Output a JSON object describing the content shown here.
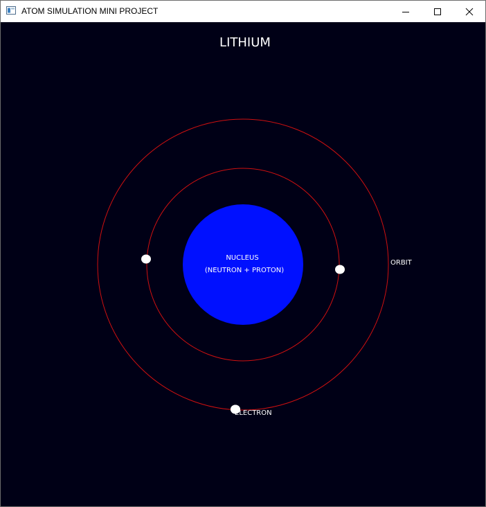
{
  "window": {
    "title": "ATOM SIMULATION MINI PROJECT",
    "controls": [
      "minimize-icon",
      "maximize-icon",
      "close-icon"
    ]
  },
  "scene": {
    "element_name": "LITHIUM",
    "nucleus_label": "NUCLEUS",
    "nucleus_sublabel": "(NEUTRON + PROTON)",
    "orbit_label": "ORBIT",
    "electron_label": "ELECTRON",
    "electron_count": 3,
    "orbit_count": 2
  },
  "colors": {
    "background": "#000016",
    "nucleus": "#0010ff",
    "orbit": "#d01010",
    "electron": "#ffffff",
    "text": "#ffffff"
  }
}
